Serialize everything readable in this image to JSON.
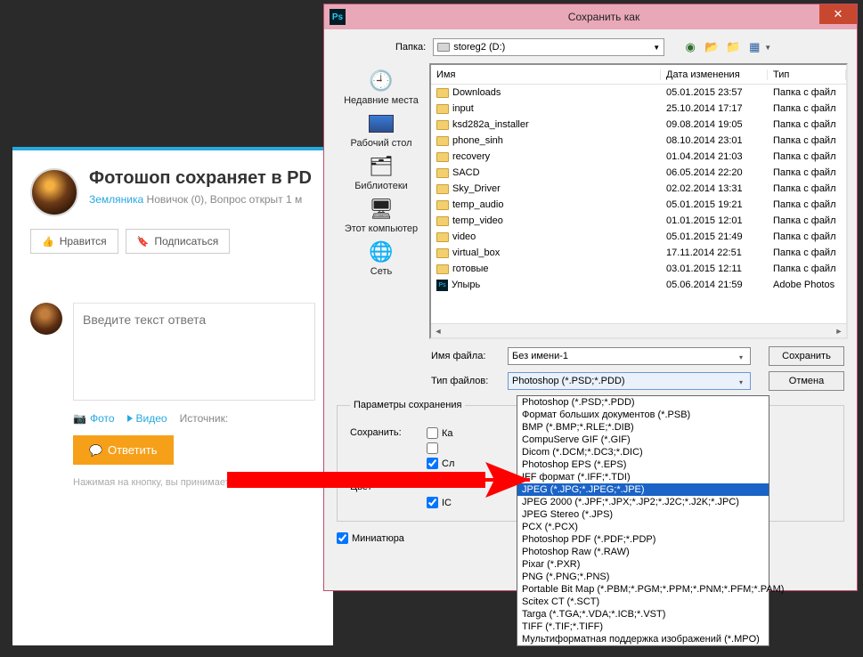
{
  "webpage": {
    "title": "Фотошоп сохраняет в PD",
    "author": "Земляника",
    "author_suffix": " Новичок (0), Вопрос открыт 1 м",
    "like_btn": "Нравится",
    "sub_btn": "Подписаться",
    "answer_placeholder": "Введите текст ответа",
    "photo": "Фото",
    "video": "Видео",
    "source": "Источник:",
    "answer_btn": "Ответить",
    "disclaimer": "Нажимая на кнопку, вы принимаете услови"
  },
  "window": {
    "title": "Сохранить как",
    "folder_label": "Папка:",
    "folder_value": "storeg2 (D:)",
    "places": {
      "recent": "Недавние места",
      "desktop": "Рабочий стол",
      "libs": "Библиотеки",
      "pc": "Этот компьютер",
      "net": "Сеть"
    },
    "cols": {
      "name": "Имя",
      "date": "Дата изменения",
      "type": "Тип"
    },
    "rows": [
      {
        "name": "Downloads",
        "date": "05.01.2015 23:57",
        "type": "Папка с файл",
        "kind": "folder"
      },
      {
        "name": "input",
        "date": "25.10.2014 17:17",
        "type": "Папка с файл",
        "kind": "folder"
      },
      {
        "name": "ksd282a_installer",
        "date": "09.08.2014 19:05",
        "type": "Папка с файл",
        "kind": "folder"
      },
      {
        "name": "phone_sinh",
        "date": "08.10.2014 23:01",
        "type": "Папка с файл",
        "kind": "folder"
      },
      {
        "name": "recovery",
        "date": "01.04.2014 21:03",
        "type": "Папка с файл",
        "kind": "folder"
      },
      {
        "name": "SACD",
        "date": "06.05.2014 22:20",
        "type": "Папка с файл",
        "kind": "folder"
      },
      {
        "name": "Sky_Driver",
        "date": "02.02.2014 13:31",
        "type": "Папка с файл",
        "kind": "folder"
      },
      {
        "name": "temp_audio",
        "date": "05.01.2015 19:21",
        "type": "Папка с файл",
        "kind": "folder"
      },
      {
        "name": "temp_video",
        "date": "01.01.2015 12:01",
        "type": "Папка с файл",
        "kind": "folder"
      },
      {
        "name": "video",
        "date": "05.01.2015 21:49",
        "type": "Папка с файл",
        "kind": "folder"
      },
      {
        "name": "virtual_box",
        "date": "17.11.2014 22:51",
        "type": "Папка с файл",
        "kind": "folder"
      },
      {
        "name": "готовые",
        "date": "03.01.2015 12:11",
        "type": "Папка с файл",
        "kind": "folder"
      },
      {
        "name": "Упырь",
        "date": "05.06.2014 21:59",
        "type": "Adobe Photos",
        "kind": "psd"
      }
    ],
    "filename_label": "Имя файла:",
    "filename_value": "Без имени-1",
    "filetype_label": "Тип файлов:",
    "filetype_value": "Photoshop (*.PSD;*.PDD)",
    "save_btn": "Сохранить",
    "cancel_btn": "Отмена",
    "params_title": "Параметры сохранения",
    "save_label": "Сохранить:",
    "chk_copy": "Ка",
    "chk_alpha_cut": "",
    "chk_layers": "Сл",
    "color_label": "Цвет",
    "chk_icc": "IC",
    "chk_thumb": "Миниатюра"
  },
  "dropdown": [
    "Photoshop (*.PSD;*.PDD)",
    "Формат больших документов (*.PSB)",
    "BMP (*.BMP;*.RLE;*.DIB)",
    "CompuServe GIF (*.GIF)",
    "Dicom (*.DCM;*.DC3;*.DIC)",
    "Photoshop EPS (*.EPS)",
    "IFF формат (*.IFF;*.TDI)",
    "JPEG (*.JPG;*.JPEG;*.JPE)",
    "JPEG 2000 (*.JPF;*.JPX;*.JP2;*.J2C;*.J2K;*.JPC)",
    "JPEG Stereo (*.JPS)",
    "PCX (*.PCX)",
    "Photoshop PDF (*.PDF;*.PDP)",
    "Photoshop Raw (*.RAW)",
    "Pixar (*.PXR)",
    "PNG (*.PNG;*.PNS)",
    "Portable Bit Map (*.PBM;*.PGM;*.PPM;*.PNM;*.PFM;*.PAM)",
    "Scitex CT (*.SCT)",
    "Targa (*.TGA;*.VDA;*.ICB;*.VST)",
    "TIFF (*.TIF;*.TIFF)",
    "Мультиформатная поддержка изображений  (*.MPO)"
  ],
  "dropdown_highlight_index": 7
}
